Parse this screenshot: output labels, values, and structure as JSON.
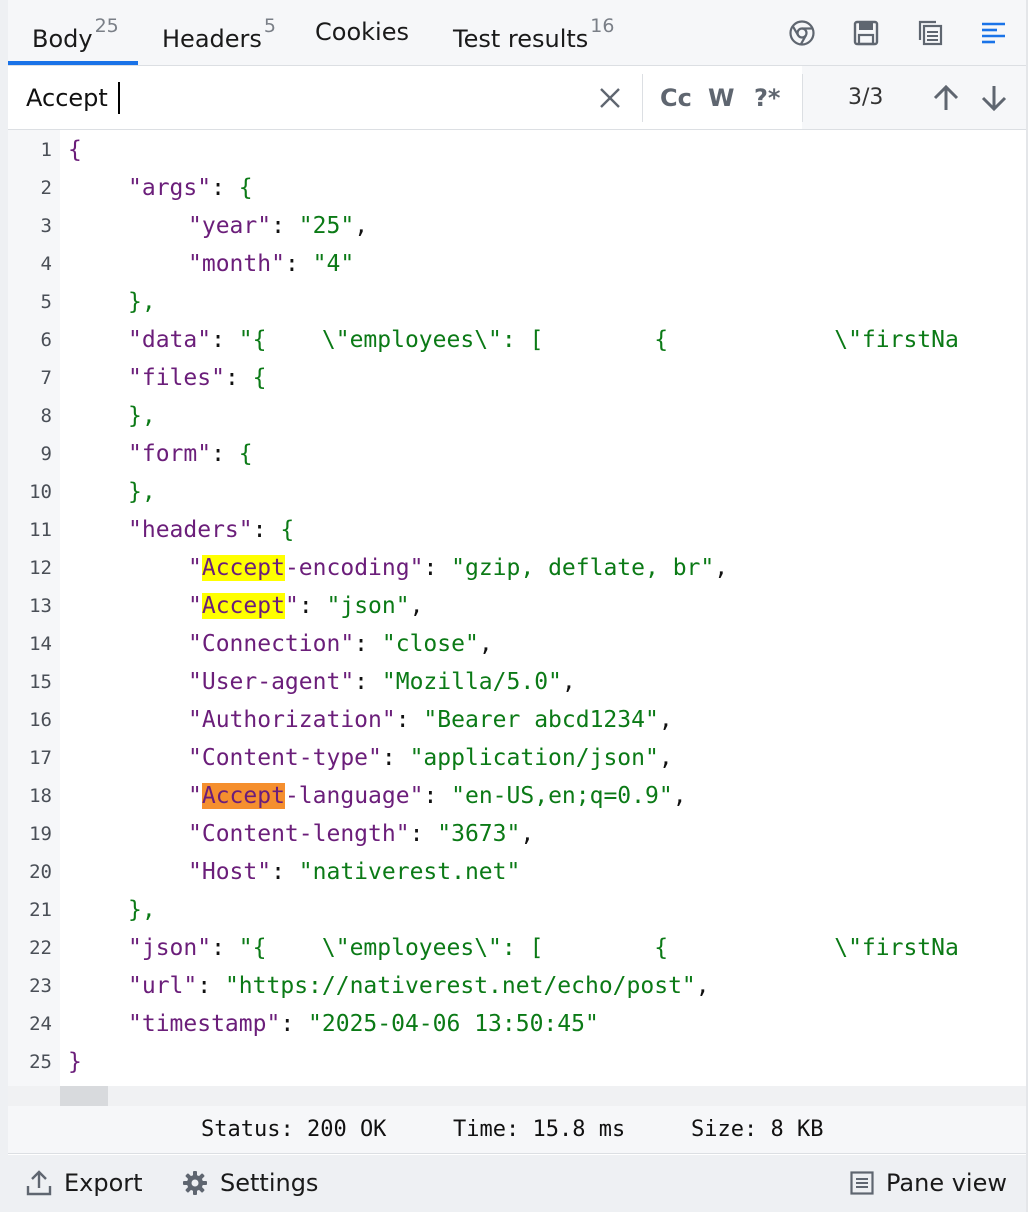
{
  "tabs": [
    {
      "label": "Body",
      "count": "25"
    },
    {
      "label": "Headers",
      "count": "5"
    },
    {
      "label": "Cookies",
      "count": ""
    },
    {
      "label": "Test results",
      "count": "16"
    }
  ],
  "toolbar_icons": [
    "chrome-icon",
    "save-icon",
    "copy-icon",
    "wrap-lines-icon"
  ],
  "search": {
    "value": "Accept",
    "options": [
      "Cc",
      "W",
      "?*"
    ],
    "match_count": "3/3"
  },
  "line_numbers": [
    "1",
    "2",
    "3",
    "4",
    "5",
    "6",
    "7",
    "8",
    "9",
    "10",
    "11",
    "12",
    "13",
    "14",
    "15",
    "16",
    "17",
    "18",
    "19",
    "20",
    "21",
    "22",
    "23",
    "24",
    "25"
  ],
  "code": {
    "l1": "{",
    "l2_key": "\"args\"",
    "l2_rest": ": ",
    "l2_brace": "{",
    "l3_key": "\"year\"",
    "l3_sep": ": ",
    "l3_val": "\"25\"",
    "l3_end": ",",
    "l4_key": "\"month\"",
    "l4_sep": ": ",
    "l4_val": "\"4\"",
    "l5": "},",
    "l6_key": "\"data\"",
    "l6_sep": ": ",
    "l6_val": "\"{    \\\"employees\\\": [        {            \\\"firstNa",
    "l7_key": "\"files\"",
    "l7_sep": ": ",
    "l7_brace": "{",
    "l8": "},",
    "l9_key": "\"form\"",
    "l9_sep": ": ",
    "l9_brace": "{",
    "l10": "},",
    "l11_key": "\"headers\"",
    "l11_sep": ": ",
    "l11_brace": "{",
    "l12_q": "\"",
    "l12_match": "Accept",
    "l12_keyrest": "-encoding\"",
    "l12_sep": ": ",
    "l12_val": "\"gzip, deflate, br\"",
    "l12_end": ",",
    "l13_q": "\"",
    "l13_match": "Accept",
    "l13_keyrest": "\"",
    "l13_sep": ": ",
    "l13_val": "\"json\"",
    "l13_end": ",",
    "l14_key": "\"Connection\"",
    "l14_sep": ": ",
    "l14_val": "\"close\"",
    "l14_end": ",",
    "l15_key": "\"User-agent\"",
    "l15_sep": ": ",
    "l15_val": "\"Mozilla/5.0\"",
    "l15_end": ",",
    "l16_key": "\"Authorization\"",
    "l16_sep": ": ",
    "l16_val": "\"Bearer abcd1234\"",
    "l16_end": ",",
    "l17_key": "\"Content-type\"",
    "l17_sep": ": ",
    "l17_val": "\"application/json\"",
    "l17_end": ",",
    "l18_q": "\"",
    "l18_match": "Accept",
    "l18_keyrest": "-language\"",
    "l18_sep": ": ",
    "l18_val": "\"en-US,en;q=0.9\"",
    "l18_end": ",",
    "l19_key": "\"Content-length\"",
    "l19_sep": ": ",
    "l19_val": "\"3673\"",
    "l19_end": ",",
    "l20_key": "\"Host\"",
    "l20_sep": ": ",
    "l20_val": "\"nativerest.net\"",
    "l21": "},",
    "l22_key": "\"json\"",
    "l22_sep": ": ",
    "l22_val": "\"{    \\\"employees\\\": [        {            \\\"firstNa",
    "l23_key": "\"url\"",
    "l23_sep": ": ",
    "l23_val": "\"https://nativerest.net/echo/post\"",
    "l23_end": ",",
    "l24_key": "\"timestamp\"",
    "l24_sep": ": ",
    "l24_val": "\"2025-04-06 13:50:45\"",
    "l25": "}"
  },
  "status": {
    "status": "Status: 200 OK",
    "time": "Time: 15.8 ms",
    "size": "Size: 8 KB"
  },
  "footer": {
    "export_label": "Export",
    "settings_label": "Settings",
    "pane_view_label": "Pane view"
  },
  "colors": {
    "accent": "#1a73e8",
    "key": "#6b1e7a",
    "string": "#0b7a16",
    "match": "#ffff00",
    "current_match": "#f58f2e"
  }
}
